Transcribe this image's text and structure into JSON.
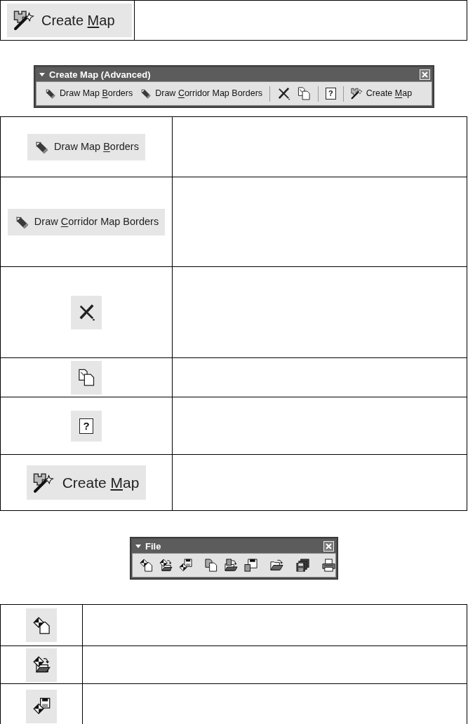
{
  "intro_table": {
    "button": {
      "kind": "labeled",
      "label": [
        {
          "text": "Create ",
          "underlined": false
        },
        {
          "text": "M",
          "underlined": true
        },
        {
          "text": "ap",
          "underlined": false
        }
      ]
    }
  },
  "create_map_toolbar": {
    "title": "Create Map (Advanced)",
    "groups": [
      {
        "items": [
          {
            "kind": "labeled",
            "label": [
              {
                "text": "Draw Map ",
                "underlined": false
              },
              {
                "text": "B",
                "underlined": true
              },
              {
                "text": "orders",
                "underlined": false
              }
            ]
          },
          {
            "kind": "labeled",
            "label": [
              {
                "text": "Draw ",
                "underlined": false
              },
              {
                "text": "C",
                "underlined": true
              },
              {
                "text": "orridor Map Borders",
                "underlined": false
              }
            ]
          }
        ]
      },
      {
        "items": [
          {
            "kind": "icon"
          },
          {
            "kind": "icon"
          }
        ]
      },
      {
        "items": [
          {
            "kind": "glyph",
            "glyph": "?"
          }
        ]
      },
      {
        "items": [
          {
            "kind": "labeled",
            "label": [
              {
                "text": "Create ",
                "underlined": false
              },
              {
                "text": "M",
                "underlined": true
              },
              {
                "text": "ap",
                "underlined": false
              }
            ]
          }
        ]
      }
    ]
  },
  "create_map_table": {
    "rows": [
      {
        "kind": "labeled",
        "label": [
          {
            "text": "Draw Map ",
            "underlined": false
          },
          {
            "text": "B",
            "underlined": true
          },
          {
            "text": "orders",
            "underlined": false
          }
        ]
      },
      {
        "kind": "labeled",
        "label": [
          {
            "text": "Draw ",
            "underlined": false
          },
          {
            "text": "C",
            "underlined": true
          },
          {
            "text": "orridor Map Borders",
            "underlined": false
          }
        ]
      },
      {
        "kind": "icon"
      },
      {
        "kind": "icon"
      },
      {
        "kind": "glyph",
        "glyph": "?"
      },
      {
        "kind": "labeled",
        "label": [
          {
            "text": "Create ",
            "underlined": false
          },
          {
            "text": "M",
            "underlined": true
          },
          {
            "text": "ap",
            "underlined": false
          }
        ]
      }
    ]
  },
  "file_toolbar": {
    "title": "File",
    "groups": [
      {
        "items": [
          {
            "kind": "icon"
          },
          {
            "kind": "icon"
          },
          {
            "kind": "icon"
          }
        ]
      },
      {
        "items": [
          {
            "kind": "icon"
          },
          {
            "kind": "icon"
          },
          {
            "kind": "icon"
          }
        ]
      },
      {
        "items": [
          {
            "kind": "icon"
          }
        ]
      },
      {
        "items": [
          {
            "kind": "icon"
          }
        ]
      },
      {
        "items": [
          {
            "kind": "icon"
          }
        ]
      }
    ]
  },
  "file_table": {
    "rows": [
      {
        "kind": "icon"
      },
      {
        "kind": "icon"
      },
      {
        "kind": "icon"
      }
    ]
  }
}
